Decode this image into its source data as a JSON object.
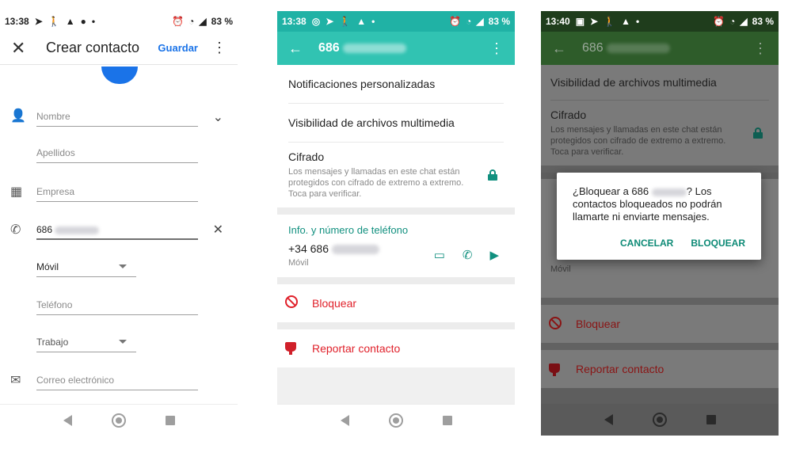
{
  "colors": {
    "google_blue": "#1a73e8",
    "whatsapp_teal": "#31c3b2",
    "whatsapp_green_text": "#11907f",
    "danger_red": "#e0202a"
  },
  "phone1": {
    "status": {
      "time": "13:38",
      "battery": "83 %"
    },
    "header": {
      "close_icon": "close-icon",
      "title": "Crear contacto",
      "save": "Guardar"
    },
    "fields": {
      "nombre": "Nombre",
      "apellidos": "Apellidos",
      "empresa": "Empresa",
      "telefono_value": "686",
      "phone_type": "Móvil",
      "telefono2": "Teléfono",
      "trabajo": "Trabajo",
      "correo": "Correo electrónico"
    }
  },
  "phone2": {
    "status": {
      "time": "13:38",
      "battery": "83 %"
    },
    "header": {
      "name": "686"
    },
    "rows": {
      "notif": "Notificaciones personalizadas",
      "visibilidad": "Visibilidad de archivos multimedia"
    },
    "cifrado": {
      "title": "Cifrado",
      "desc1": "Los mensajes y llamadas en este chat están",
      "desc2": "protegidos con cifrado de extremo a extremo.",
      "desc3": "Toca para verificar."
    },
    "info": {
      "title": "Info. y número de teléfono",
      "number": "+34 686",
      "type": "Móvil"
    },
    "bloquear": "Bloquear",
    "reportar": "Reportar contacto"
  },
  "phone3": {
    "status": {
      "time": "13:40",
      "battery": "83 %"
    },
    "header": {
      "name": "686"
    },
    "visibilidad": "Visibilidad de archivos multimedia",
    "cifrado": {
      "title": "Cifrado",
      "desc1": "Los mensajes y llamadas en este chat están",
      "desc2": "protegidos con cifrado de extremo a extremo.",
      "desc3": "Toca para verificar."
    },
    "under_type": "Móvil",
    "bloquear": "Bloquear",
    "reportar": "Reportar contacto",
    "dialog": {
      "line1": "¿Bloquear a 686",
      "line1b": "? Los",
      "line2": "contactos bloqueados no podrán",
      "line3": "llamarte ni enviarte mensajes.",
      "cancel": "CANCELAR",
      "confirm": "BLOQUEAR"
    }
  }
}
